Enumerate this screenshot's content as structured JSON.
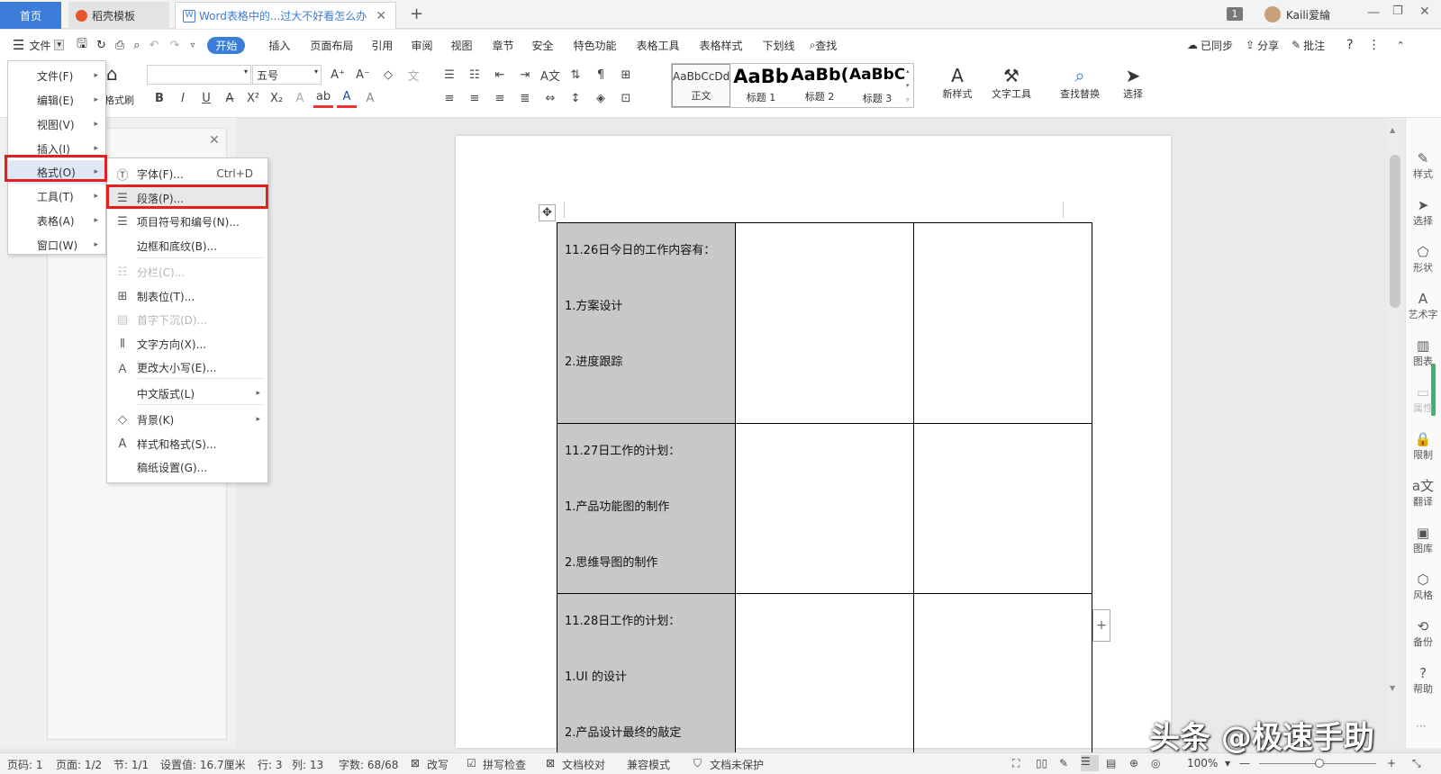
{
  "tabs": {
    "home": "首页",
    "shell": "稻壳模板",
    "doc": "Word表格中的...过大不好看怎么办",
    "new_tab": "+"
  },
  "window": {
    "page_badge": "1",
    "user": "Kaili爱綸"
  },
  "menu_row": {
    "file": "文件",
    "start": "开始",
    "items": [
      "插入",
      "页面布局",
      "引用",
      "审阅",
      "视图",
      "章节",
      "安全",
      "特色功能",
      "表格工具",
      "表格样式",
      "下划线"
    ],
    "search": "查找",
    "sync": "已同步",
    "share": "分享",
    "comment": "批注",
    "help": "?"
  },
  "ribbon": {
    "format_painter": "格式刷",
    "font_size": "五号",
    "styles": [
      {
        "preview": "AaBbCcDd",
        "label": "正文"
      },
      {
        "preview": "AaBb",
        "label": "标题 1"
      },
      {
        "preview": "AaBb(",
        "label": "标题 2"
      },
      {
        "preview": "AaBbC(",
        "label": "标题 3"
      }
    ],
    "new_style": "新样式",
    "text_tools": "文字工具",
    "find_replace": "查找替换",
    "select": "选择"
  },
  "menu1": [
    {
      "label": "文件(F)"
    },
    {
      "label": "编辑(E)"
    },
    {
      "label": "视图(V)"
    },
    {
      "label": "插入(I)"
    },
    {
      "label": "格式(O)"
    },
    {
      "label": "工具(T)"
    },
    {
      "label": "表格(A)"
    },
    {
      "label": "窗口(W)"
    }
  ],
  "menu2": [
    {
      "label": "字体(F)...",
      "shortcut": "Ctrl+D",
      "icon": "font-circle-icon"
    },
    {
      "label": "段落(P)...",
      "icon": "paragraph-icon"
    },
    {
      "label": "项目符号和编号(N)...",
      "icon": "bullet-list-icon"
    },
    {
      "label": "边框和底纹(B)..."
    },
    {
      "label": "分栏(C)...",
      "icon": "columns-icon"
    },
    {
      "label": "制表位(T)...",
      "icon": "tab-stop-icon"
    },
    {
      "label": "首字下沉(D)...",
      "icon": "drop-cap-icon"
    },
    {
      "label": "文字方向(X)...",
      "icon": "text-direction-icon"
    },
    {
      "label": "更改大小写(E)...",
      "icon": "change-case-icon"
    },
    {
      "label": "中文版式(L)"
    },
    {
      "label": "背景(K)",
      "icon": "background-icon"
    },
    {
      "label": "样式和格式(S)...",
      "icon": "styles-icon"
    },
    {
      "label": "稿纸设置(G)..."
    }
  ],
  "document": {
    "rows": [
      [
        "11.26日今日的工作内容有：",
        "1.方案设计",
        "2.进度跟踪"
      ],
      [
        "11.27日工作的计划：",
        "1.产品功能图的制作",
        "2.思维导图的制作"
      ],
      [
        "11.28日工作的计划：",
        "1.UI 的设计",
        "2.产品设计最终的敲定"
      ]
    ]
  },
  "right_sidebar": [
    "样式",
    "选择",
    "形状",
    "艺术字",
    "图表",
    "属性",
    "限制",
    "翻译",
    "图库",
    "风格",
    "备份",
    "帮助"
  ],
  "status": {
    "page_num": "页码: 1",
    "pages": "页面: 1/2",
    "section": "节: 1/1",
    "setting": "设置值: 16.7厘米",
    "row": "行: 3",
    "col": "列: 13",
    "words": "字数: 68/68",
    "revise": "改写",
    "spell": "拼写检查",
    "proof": "文档校对",
    "compat": "兼容模式",
    "protect": "文档未保护",
    "zoom": "100%"
  },
  "watermark": "头条 @极速手助"
}
